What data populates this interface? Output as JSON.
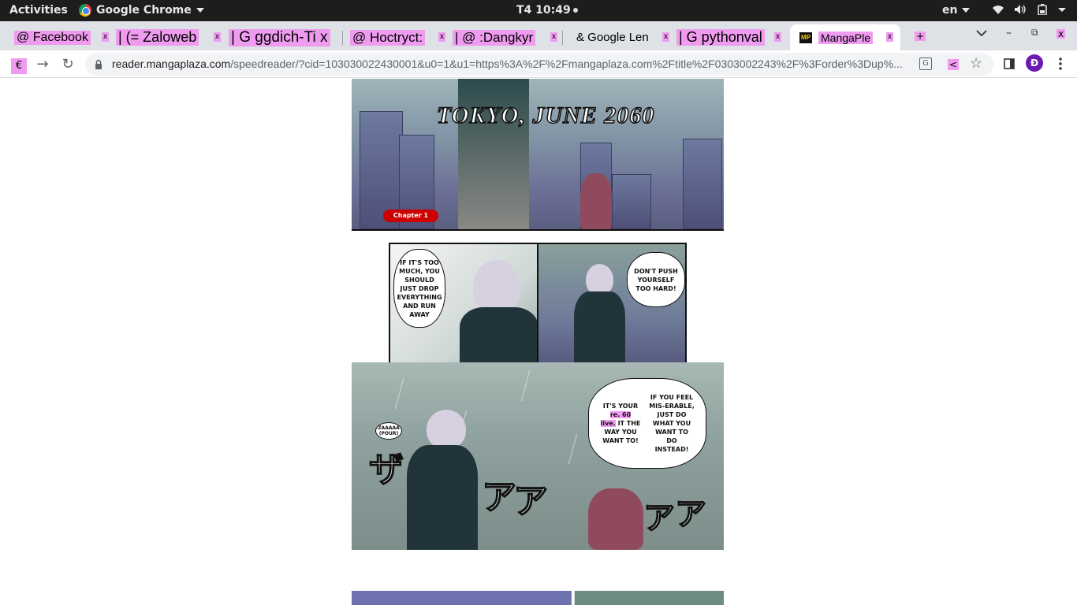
{
  "system_bar": {
    "activities": "Activities",
    "app_name": "Google Chrome",
    "clock": "T4 10:49",
    "language": "en"
  },
  "tabs": [
    {
      "title": "@ Facebook",
      "close": "x"
    },
    {
      "title": "| (= Zaloweb",
      "close": "x"
    },
    {
      "title": "| G ggdich-Ti x",
      "close": ""
    },
    {
      "title": "@ Hoctryct:",
      "close": "x"
    },
    {
      "title": "| @ :Dangkyr",
      "close": "x"
    },
    {
      "title": "& Google Len",
      "close": "x"
    },
    {
      "title": "| G pythonval",
      "close": "x"
    },
    {
      "title": "MangaPle",
      "close": "x",
      "active": true
    }
  ],
  "new_tab": "+",
  "window_controls": {
    "minimize": "–",
    "maximize": "⧉",
    "close": "x"
  },
  "toolbar": {
    "back": "€",
    "forward": "→",
    "reload": "↻",
    "share": "<",
    "star": "☆",
    "avatar": "Đ",
    "url_host": "reader.mangaplaza.com",
    "url_rest": "/speedreader/?cid=103030022430001&u0=1&u1=https%3A%2F%2Fmangaplaza.com%2Ftitle%2F0303002243%2F%3Forder%3Dup%..."
  },
  "manga": {
    "title_caption": "TOKYO, JUNE 2060",
    "chapter_badge": "Chapter 1",
    "bubble_1": "IF IT'S TOO MUCH, YOU SHOULD JUST DROP EVERYTHING AND RUN AWAY",
    "bubble_2": "DON'T PUSH YOURSELF TOO HARD!",
    "sfx_small": "ZAAAAA (POUR)",
    "bubble_3_a": "IT'S YOUR",
    "bubble_3_hl1": "re. 60",
    "bubble_3_hl2": "live.",
    "bubble_3_b": "IT THE WAY YOU WANT TO!",
    "bubble_4": "IF YOU FEEL MIS-ERABLE, JUST DO WHAT YOU WANT TO DO INSTEAD!"
  }
}
